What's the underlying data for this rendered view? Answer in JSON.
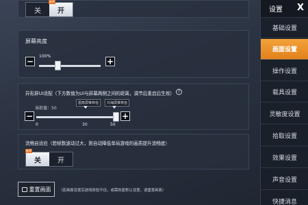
{
  "nav": {
    "header_title": "设置",
    "close_label": "X",
    "items": [
      {
        "label": "基础设置",
        "active": false
      },
      {
        "label": "画面设置",
        "active": true
      },
      {
        "label": "操作设置",
        "active": false
      },
      {
        "label": "载具设置",
        "active": false
      },
      {
        "label": "灵敏度设置",
        "active": false
      },
      {
        "label": "拾取设置",
        "active": false
      },
      {
        "label": "效果设置",
        "active": false
      },
      {
        "label": "声音设置",
        "active": false
      },
      {
        "label": "快捷消息",
        "active": false
      }
    ]
  },
  "top_toggle": {
    "off_label": "关",
    "on_label": "开",
    "selected": "开",
    "badge": "推荐"
  },
  "brightness": {
    "title": "屏幕亮度",
    "value_text": "100%",
    "minus": "−",
    "plus": "+",
    "level": 0.3
  },
  "notch": {
    "title": "异形屏UI适配（下方数值为UI与屏幕两侧之间的距离，调节后重启后生效）",
    "help_icon": "?",
    "current_label": "当前值：50",
    "tag_left": "图角屏推荐值",
    "tag_right": "刘海屏推荐值",
    "tick_min": "0",
    "tick_mid": "30",
    "tick_max": "50",
    "minus": "−",
    "plus": "+",
    "value": 50
  },
  "adaptive": {
    "title": "流畅自适应（若帧数波动过大，则自动降低单局游戏的画质提升流畅度）",
    "off_label": "关",
    "on_label": "开",
    "selected": "关",
    "badge": "推荐"
  },
  "reset": {
    "label": "重置画面",
    "note": "（若画面设置后游戏体验不佳，或需恢复默认设置，请重置画面）"
  }
}
